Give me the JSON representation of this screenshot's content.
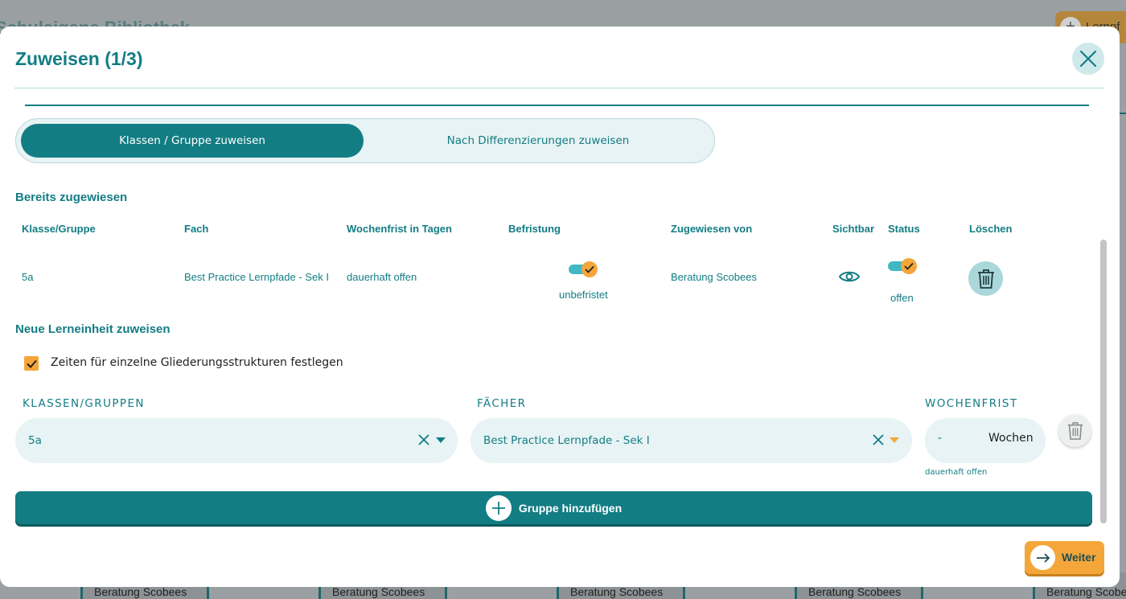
{
  "background": {
    "page_title": "Schuleigene Bibliothek",
    "top_button_label": "Lernpf",
    "card_authors": [
      "Beratung Scobees",
      "Beratung Scobees",
      "Beratung Scobees",
      "Beratung Scobees",
      "Beratung Scobe"
    ]
  },
  "modal": {
    "title": "Zuweisen (1/3)",
    "icons": {
      "close": "close-icon"
    }
  },
  "tabs": [
    {
      "label": "Klassen / Gruppe zuweisen",
      "active": true
    },
    {
      "label": "Nach Differenzierungen zuweisen",
      "active": false
    }
  ],
  "assigned": {
    "title": "Bereits zugewiesen",
    "columns": [
      "Klasse/Gruppe",
      "Fach",
      "Wochenfrist in Tagen",
      "Befristung",
      "Zugewiesen von",
      "Sichtbar",
      "Status",
      "Löschen"
    ],
    "rows": [
      {
        "klasse": "5a",
        "fach": "Best Practice Lernpfade - Sek I",
        "wochenfrist": "dauerhaft offen",
        "befristung_on": true,
        "befristung_label": "unbefristet",
        "zugewiesen_von": "Beratung Scobees",
        "sichtbar_icon": "eye-icon",
        "status_on": true,
        "status_label": "offen",
        "delete_icon": "trash-icon"
      }
    ]
  },
  "new_assignment": {
    "title": "Neue Lerneinheit zuweisen",
    "checkbox_label": "Zeiten für einzelne Gliederungsstrukturen festlegen",
    "checkbox_checked": true,
    "klassen_label": "KLASSEN/GRUPPEN",
    "klassen_value": "5a",
    "faecher_label": "FÄCHER",
    "faecher_value": "Best Practice Lernpfade - Sek I",
    "wochenfrist_label": "WOCHENFRIST",
    "wochenfrist_value": "-",
    "wochenfrist_unit": "Wochen",
    "wochenfrist_hint": "dauerhaft offen",
    "add_group_label": "Gruppe hinzufügen"
  },
  "footer": {
    "next_label": "Weiter"
  },
  "colors": {
    "primary": "#137d84",
    "accent": "#f4a63a",
    "field_bg": "#e7f3f4",
    "toggle_track": "#3fb8c2"
  }
}
